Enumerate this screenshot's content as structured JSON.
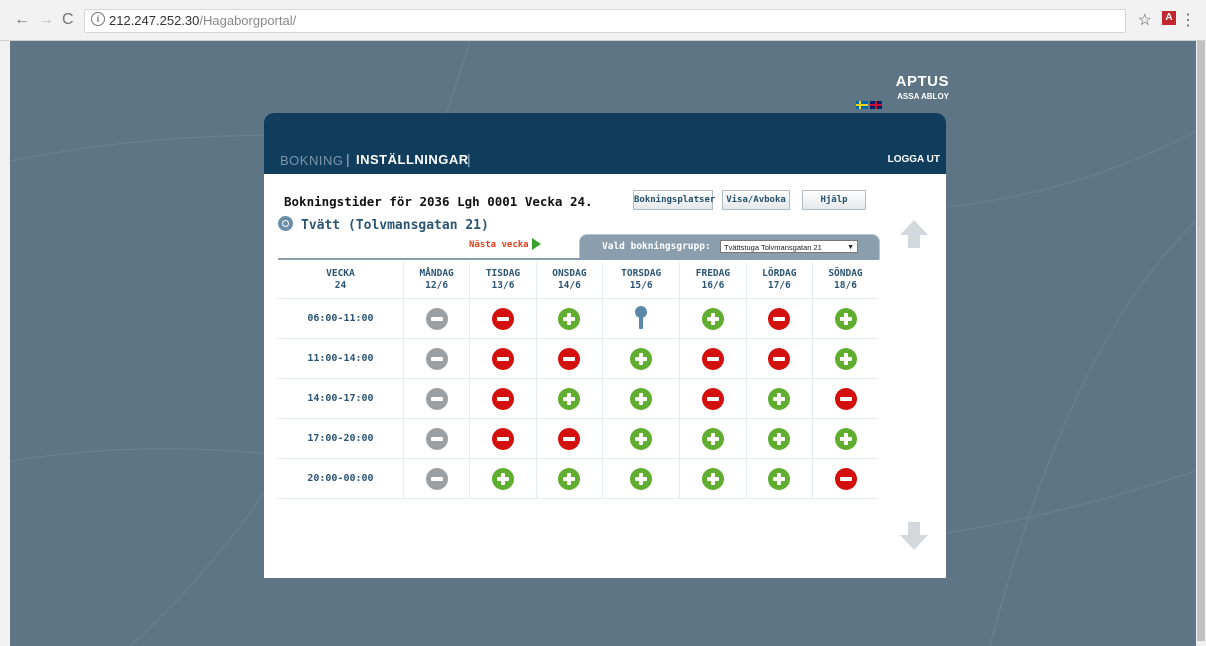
{
  "browser": {
    "back_icon": "←",
    "forward_icon": "→",
    "reload_icon": "C",
    "info_icon": "i",
    "url_host": "212.247.252.30",
    "url_path": "/Hagaborgportal/",
    "star_icon": "☆",
    "pdf_icon": "A",
    "menu_icon": "⋮"
  },
  "logo": {
    "brand": "APTUS",
    "subbrand": "ASSA ABLOY"
  },
  "nav": {
    "booking": "BOKNING",
    "settings": "INSTÄLLNINGAR",
    "separator": "|",
    "logout": "LOGGA UT"
  },
  "heading": "Bokningstider för 2036 Lgh 0001 Vecka 24.",
  "subheading": "Tvätt (Tolvmansgatan 21)",
  "buttons": {
    "places": "Bokningsplatser",
    "view": "Visa/Avboka",
    "help": "Hjälp"
  },
  "next_week": "Nästa vecka",
  "group": {
    "label": "Vald bokningsgrupp:",
    "selected": "Tvättstuga Tolvmansgatan 21",
    "dropdown_icon": "▼"
  },
  "grid": {
    "week_label": "VECKA",
    "week_number": "24",
    "days": [
      {
        "name": "MÅNDAG",
        "date": "12/6"
      },
      {
        "name": "TISDAG",
        "date": "13/6"
      },
      {
        "name": "ONSDAG",
        "date": "14/6"
      },
      {
        "name": "TORSDAG",
        "date": "15/6"
      },
      {
        "name": "FREDAG",
        "date": "16/6"
      },
      {
        "name": "LÖRDAG",
        "date": "17/6"
      },
      {
        "name": "SÖNDAG",
        "date": "18/6"
      }
    ],
    "rows": [
      {
        "time": "06:00-11:00",
        "slots": [
          "past",
          "booked",
          "free",
          "mine",
          "free",
          "booked",
          "free"
        ]
      },
      {
        "time": "11:00-14:00",
        "slots": [
          "past",
          "booked",
          "booked",
          "free",
          "booked",
          "booked",
          "free"
        ]
      },
      {
        "time": "14:00-17:00",
        "slots": [
          "past",
          "booked",
          "free",
          "free",
          "booked",
          "free",
          "booked"
        ]
      },
      {
        "time": "17:00-20:00",
        "slots": [
          "past",
          "booked",
          "booked",
          "free",
          "free",
          "free",
          "free"
        ]
      },
      {
        "time": "20:00-00:00",
        "slots": [
          "past",
          "free",
          "free",
          "free",
          "free",
          "free",
          "booked"
        ]
      }
    ]
  },
  "colors": {
    "free": "#5fae2f",
    "booked": "#d3100e",
    "past": "#9da0a3",
    "mine": "#5d89a8",
    "header": "#0f3d5b"
  }
}
